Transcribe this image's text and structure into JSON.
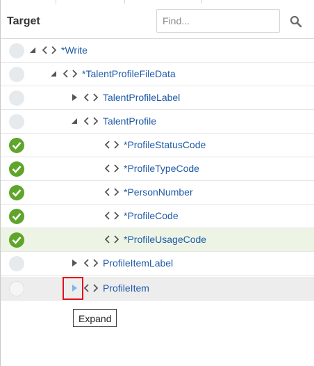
{
  "header": {
    "title": "Target",
    "search_placeholder": "Find...",
    "search_icon": "search-icon"
  },
  "tree": {
    "rows": [
      {
        "label": "*Write",
        "level": 0,
        "expanded": true,
        "status": "none"
      },
      {
        "label": "*TalentProfileFileData",
        "level": 1,
        "expanded": true,
        "status": "none"
      },
      {
        "label": "TalentProfileLabel",
        "level": 2,
        "expanded": false,
        "status": "none"
      },
      {
        "label": "TalentProfile",
        "level": 2,
        "expanded": true,
        "status": "none"
      },
      {
        "label": "*ProfileStatusCode",
        "level": 3,
        "leaf": true,
        "status": "complete"
      },
      {
        "label": "*ProfileTypeCode",
        "level": 3,
        "leaf": true,
        "status": "complete"
      },
      {
        "label": "*PersonNumber",
        "level": 3,
        "leaf": true,
        "status": "complete"
      },
      {
        "label": "*ProfileCode",
        "level": 3,
        "leaf": true,
        "status": "complete"
      },
      {
        "label": "*ProfileUsageCode",
        "level": 3,
        "leaf": true,
        "status": "complete",
        "selected": true
      },
      {
        "label": "ProfileItemLabel",
        "level": 2,
        "expanded": false,
        "status": "none"
      },
      {
        "label": "ProfileItem",
        "level": 2,
        "expanded": false,
        "status": "none",
        "hovered": true
      }
    ]
  },
  "tooltip": {
    "text": "Expand"
  },
  "colors": {
    "complete": "#5ea52a",
    "link": "#1f5aa8",
    "selected_row": "#eef4e5",
    "hover_row": "#ededed",
    "highlight": "#e0101a"
  }
}
